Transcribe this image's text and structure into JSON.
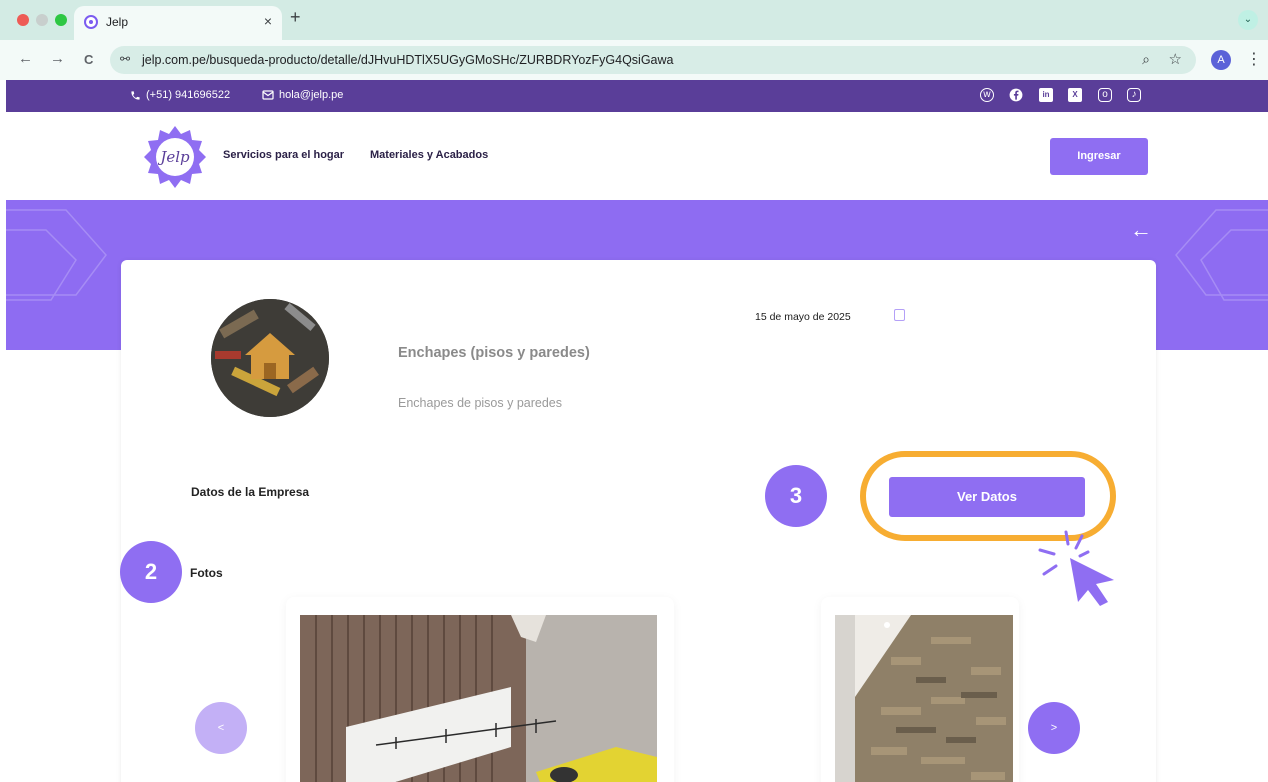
{
  "browser": {
    "tab_title": "Jelp",
    "tab_close": "×",
    "new_tab": "+",
    "profile_menu": "⌄",
    "back": "←",
    "forward": "→",
    "reload": "C",
    "site_info": "⚯",
    "url_domain": "jelp.com.pe",
    "url_path": "/busqueda-producto/detalle/dJHvuHDTlX5UGyGMoSHc/ZURBDRYozFyG4QsiGawa",
    "zoom": "⌕",
    "star": "☆",
    "avatar_letter": "A",
    "menu": "⋮"
  },
  "topbar": {
    "phone": "(+51) 941696522",
    "email": "hola@jelp.pe",
    "phone_icon": "phone-icon",
    "email_icon": "mail-icon",
    "socials": [
      "whatsapp-icon",
      "facebook-icon",
      "linkedin-icon",
      "x-icon",
      "instagram-icon",
      "tiktok-icon"
    ]
  },
  "header": {
    "logo_text": "Jelp",
    "nav": [
      "Servicios para el hogar",
      "Materiales y Acabados"
    ],
    "login_label": "Ingresar"
  },
  "service": {
    "title": "Enchapes (pisos y paredes)",
    "subtitle": "Enchapes de pisos y paredes",
    "date": "15 de mayo de 2025",
    "company_heading": "Datos de la Empresa",
    "ver_datos_label": "Ver Datos",
    "fotos_heading": "Fotos",
    "prev_label": "<",
    "next_label": ">"
  },
  "tutorial": {
    "step_photos": "2",
    "step_ver_datos": "3"
  },
  "colors": {
    "brand_purple": "#8f6ef2",
    "topbar_purple": "#5a3e99",
    "highlight_orange": "#f7ad32",
    "browser_green": "#d3ebe4"
  }
}
